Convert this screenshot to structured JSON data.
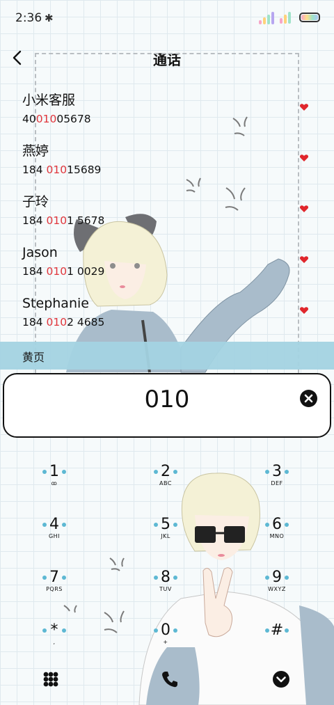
{
  "status_bar": {
    "time": "2:36",
    "bluetooth_icon": "bluetooth-icon",
    "signal_icon": "signal-icon",
    "wifi_icon": "wifi-icon",
    "battery_icon": "battery-icon"
  },
  "header": {
    "title": "通话",
    "back_icon": "chevron-left-icon"
  },
  "contacts": [
    {
      "name": "小米客服",
      "number_pre": "40",
      "number_match": "010",
      "number_post": "05678"
    },
    {
      "name": "燕婷",
      "number_pre": "184 ",
      "number_match": "010",
      "number_post": "15689"
    },
    {
      "name": "子玲",
      "number_pre": "184 ",
      "number_match": "010",
      "number_post": "1 5678"
    },
    {
      "name": "Jason",
      "number_pre": "184 ",
      "number_match": "010",
      "number_post": "1 0029"
    },
    {
      "name": "Stephanie",
      "number_pre": "184 ",
      "number_match": "010",
      "number_post": "2 4685"
    }
  ],
  "section": {
    "label": "黄页"
  },
  "input": {
    "value": "010",
    "clear_icon": "close-circle-icon"
  },
  "dialpad": {
    "keys": [
      {
        "digit": "1",
        "letters": "ꝏ"
      },
      {
        "digit": "2",
        "letters": "ABC"
      },
      {
        "digit": "3",
        "letters": "DEF"
      },
      {
        "digit": "4",
        "letters": "GHI"
      },
      {
        "digit": "5",
        "letters": "JKL"
      },
      {
        "digit": "6",
        "letters": "MNO"
      },
      {
        "digit": "7",
        "letters": "PQRS"
      },
      {
        "digit": "8",
        "letters": "TUV"
      },
      {
        "digit": "9",
        "letters": "WXYZ"
      },
      {
        "digit": "*",
        "letters": ","
      },
      {
        "digit": "0",
        "letters": "+"
      },
      {
        "digit": "#",
        "letters": ""
      }
    ]
  },
  "bottom_bar": {
    "left_icon": "dialpad-grid-icon",
    "center_icon": "phone-icon",
    "right_icon": "chevron-down-circle-icon"
  },
  "colors": {
    "accent": "#a3d3e1",
    "highlight": "#e0363c",
    "dot": "#5db8d3"
  }
}
